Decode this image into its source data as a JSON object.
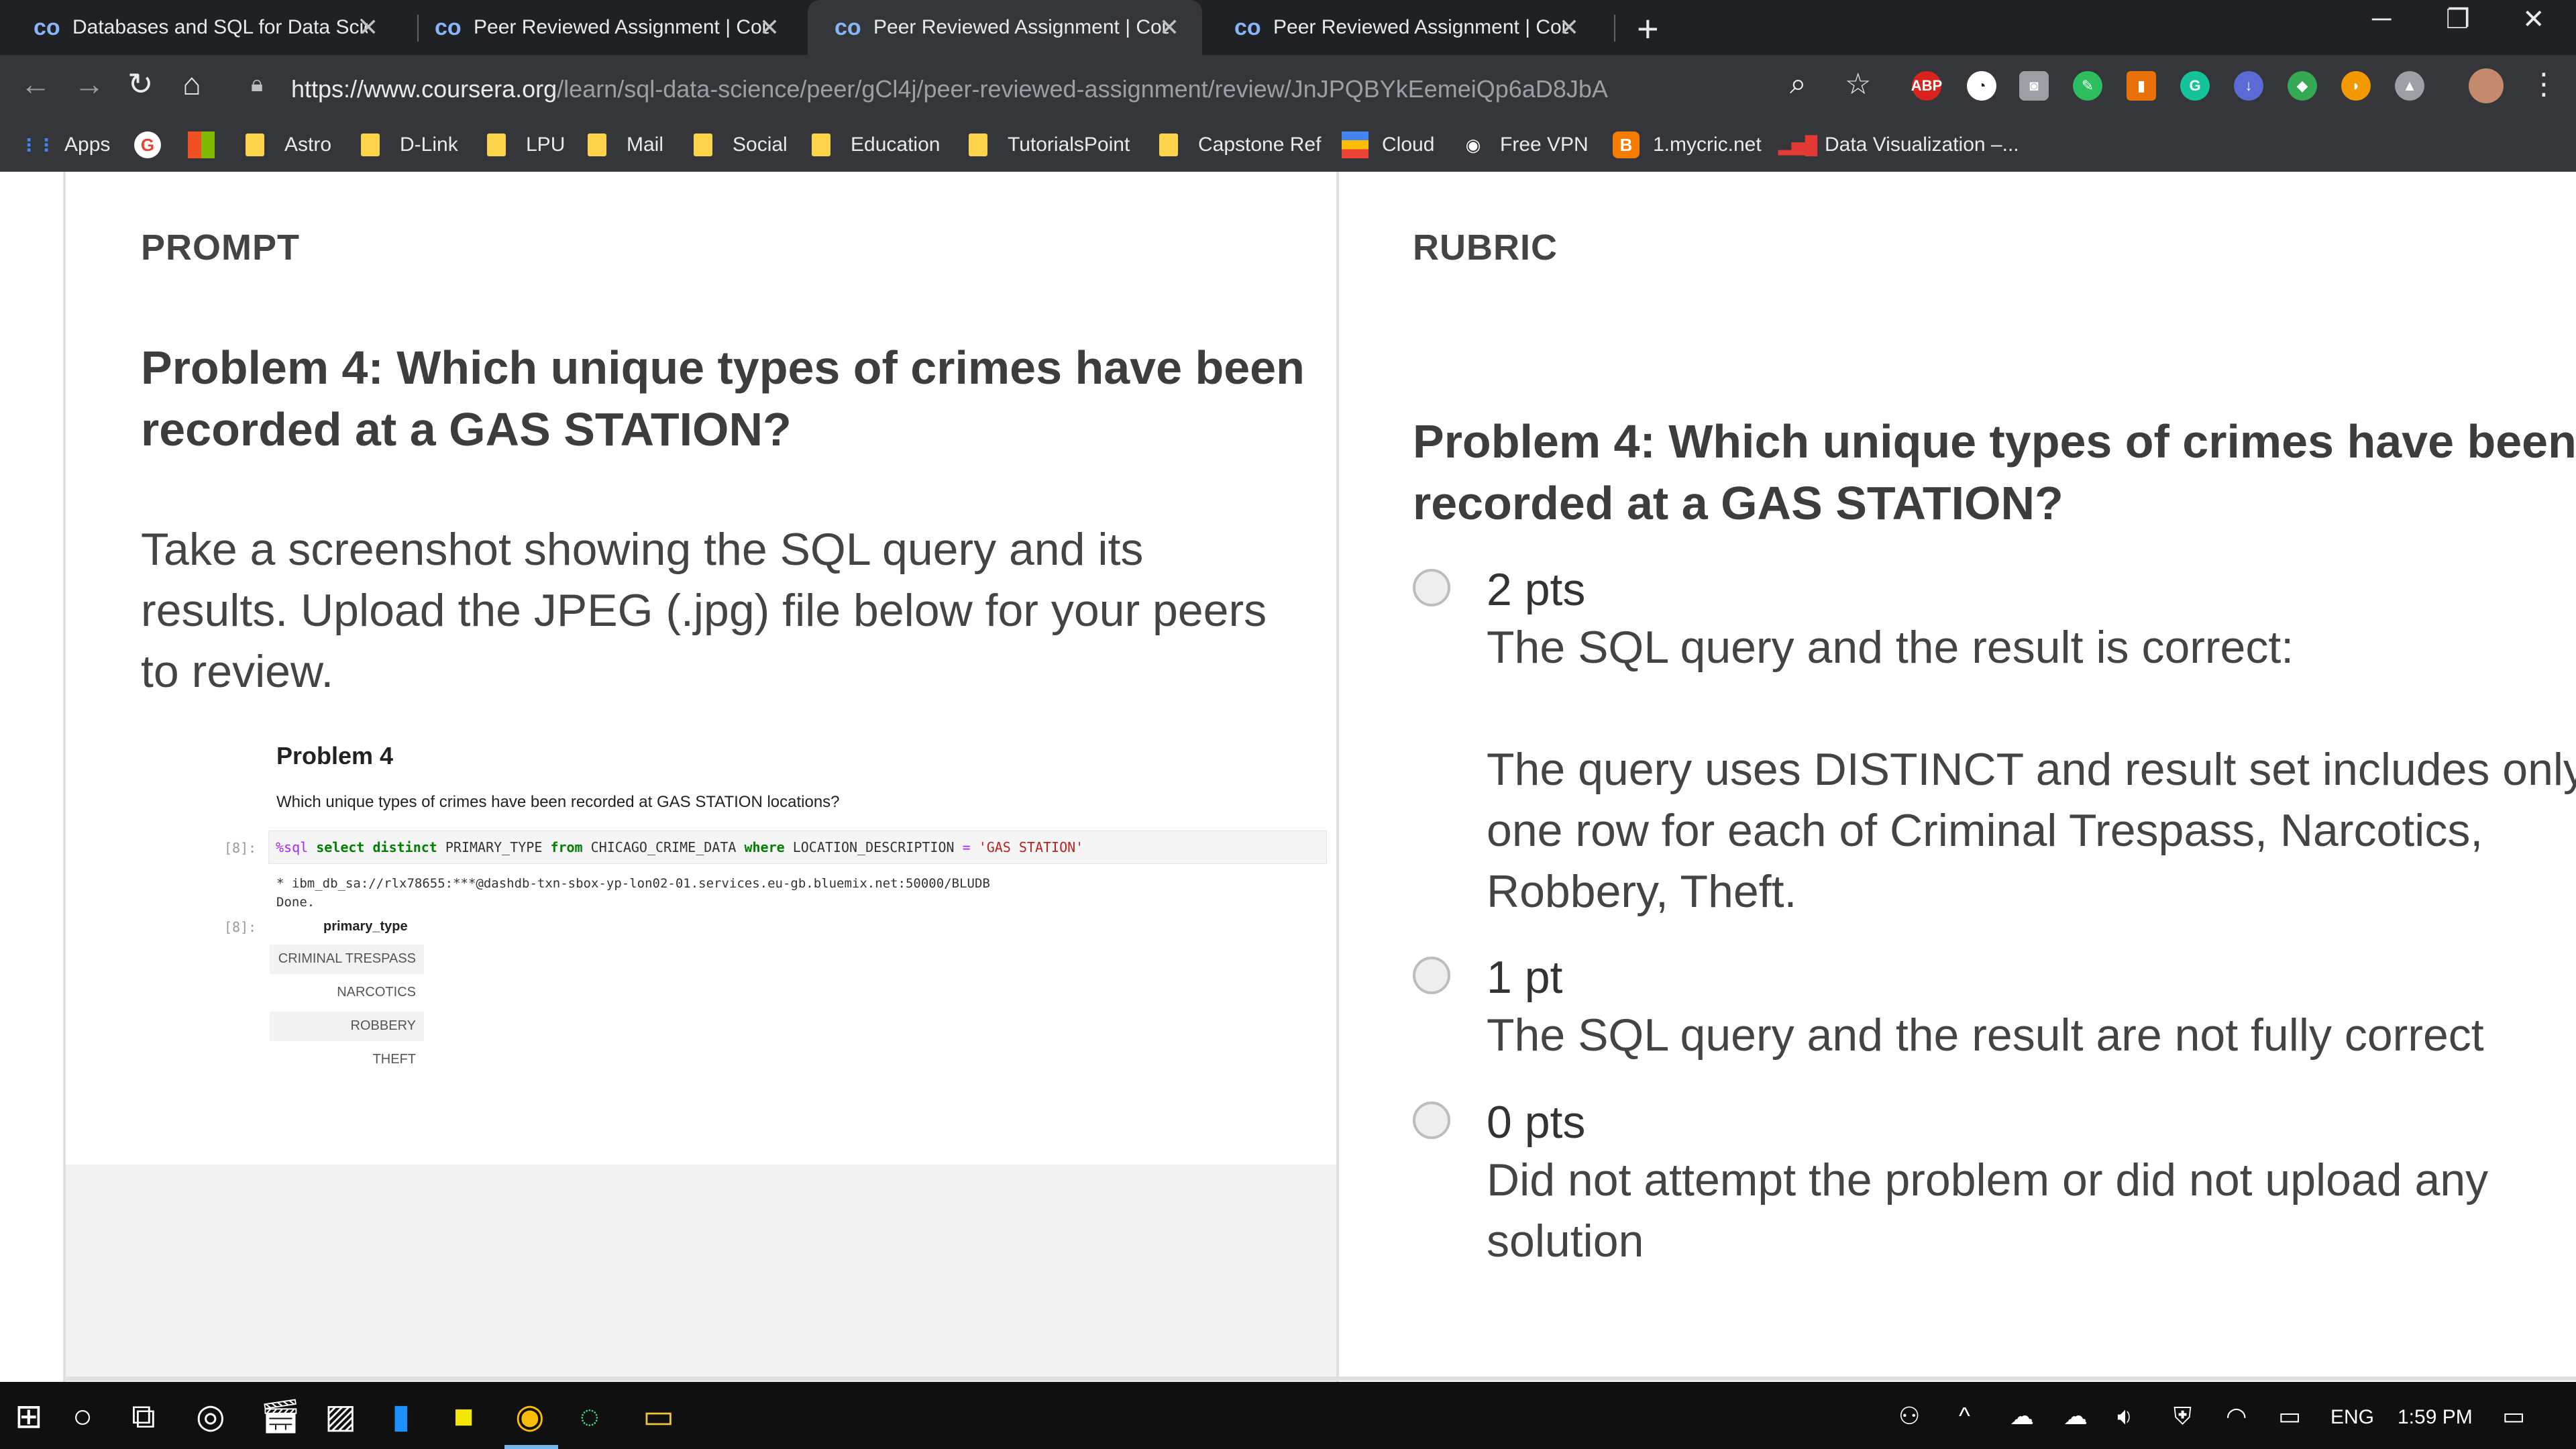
{
  "browser": {
    "tabs": [
      {
        "title": "Databases and SQL for Data Scie",
        "active": false
      },
      {
        "title": "Peer Reviewed Assignment | Cou",
        "active": false
      },
      {
        "title": "Peer Reviewed Assignment | Cou",
        "active": true
      },
      {
        "title": "Peer Reviewed Assignment | Cou",
        "active": false
      }
    ],
    "new_tab": "+",
    "url_host": "https://www.coursera.org",
    "url_path": "/learn/sql-data-science/peer/gCl4j/peer-reviewed-assignment/review/JnJPQBYkEemeiQp6aD8JbA",
    "extensions": {
      "abp": "ABP",
      "grammarly": "G"
    },
    "bookmarks": [
      "Apps",
      "Astro",
      "D-Link",
      "LPU",
      "Mail",
      "Social",
      "Education",
      "TutorialsPoint",
      "Capstone Ref",
      "Cloud",
      "Free VPN",
      "1.mycric.net",
      "Data Visualization –..."
    ]
  },
  "prompt": {
    "label": "PROMPT",
    "title_line1": "Problem 4: Which unique types of crimes have been",
    "title_line2": "recorded at a GAS STATION?",
    "instruction_line1": "Take a screenshot showing the SQL query and its",
    "instruction_line2": "results. Upload the JPEG (.jpg) file below for your peers",
    "instruction_line3": "to review.",
    "notebook": {
      "heading": "Problem 4",
      "question": "Which unique types of crimes have been recorded at GAS STATION locations?",
      "in_prompt": "[8]:",
      "out_prompt": "[8]:",
      "code_magic": "%sql",
      "code_kw1": "select",
      "code_kw2": "distinct",
      "code_col": "PRIMARY_TYPE",
      "code_kw3": "from",
      "code_table": "CHICAGO_CRIME_DATA",
      "code_kw4": "where",
      "code_cond": "LOCATION_DESCRIPTION",
      "code_eq": "=",
      "code_str": "'GAS STATION'",
      "conn": " * ibm_db_sa://rlx78655:***@dashdb-txn-sbox-yp-lon02-01.services.eu-gb.bluemix.net:50000/BLUDB",
      "done": "Done.",
      "column": "primary_type",
      "rows": [
        "CRIMINAL TRESPASS",
        "NARCOTICS",
        "ROBBERY",
        "THEFT"
      ]
    }
  },
  "rubric": {
    "label": "RUBRIC",
    "title_line1": "Problem 4: Which unique types of crimes have been",
    "title_line2": "recorded at a GAS STATION?",
    "options": [
      {
        "points": "2 pts",
        "desc1": "The SQL query and the result is correct:",
        "desc2": "The query uses DISTINCT and result set includes only",
        "desc3": "one row for each of Criminal Trespass, Narcotics,",
        "desc4": "Robbery, Theft."
      },
      {
        "points": "1 pt",
        "desc1": "The SQL query and the result are not fully correct"
      },
      {
        "points": "0 pts",
        "desc1": "Did not attempt the problem or did not upload any",
        "desc2": "solution"
      }
    ]
  },
  "taskbar": {
    "language": "ENG",
    "time": "1:59 PM"
  }
}
